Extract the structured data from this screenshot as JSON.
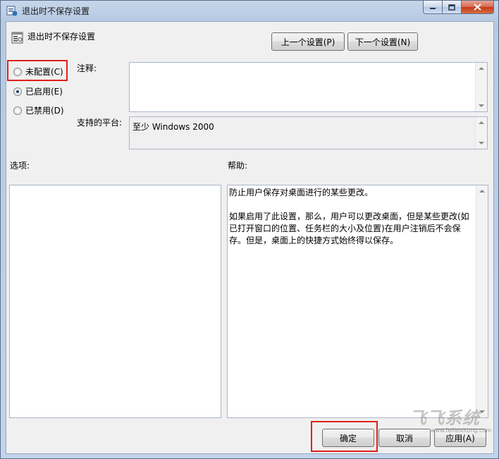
{
  "window": {
    "title": "退出时不保存设置",
    "controls": {
      "minimize": "minimize",
      "maximize": "maximize",
      "close": "close"
    }
  },
  "header": {
    "title": "退出时不保存设置",
    "prev_button": "上一个设置(P)",
    "next_button": "下一个设置(N)"
  },
  "state": {
    "options": [
      {
        "label": "未配置(C)",
        "checked": false
      },
      {
        "label": "已启用(E)",
        "checked": true
      },
      {
        "label": "已禁用(D)",
        "checked": false
      }
    ]
  },
  "comment": {
    "label": "注释:",
    "value": ""
  },
  "platform": {
    "label": "支持的平台:",
    "value": "至少 Windows 2000"
  },
  "options_section": {
    "label": "选项:"
  },
  "help_section": {
    "label": "帮助:",
    "text": "防止用户保存对桌面进行的某些更改。\n\n如果启用了此设置，那么，用户可以更改桌面，但是某些更改(如已打开窗口的位置、任务栏的大小及位置)在用户注销后不会保存。但是，桌面上的快捷方式始终得以保存。"
  },
  "footer": {
    "ok": "确定",
    "cancel": "取消",
    "apply": "应用(A)"
  },
  "watermark": {
    "logo": "飞飞系统",
    "url": "www.feifeixitong.com"
  },
  "colors": {
    "highlight": "#e0201a",
    "selected_radio": "#1b3c6e"
  }
}
